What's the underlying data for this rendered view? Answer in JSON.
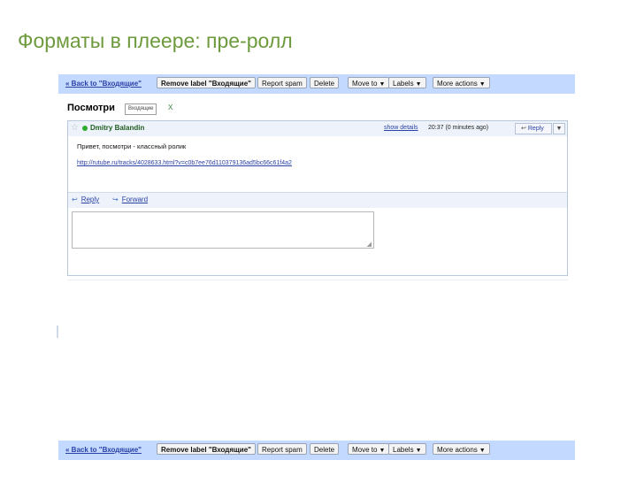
{
  "slide": {
    "title": "Форматы в плеере: пре-ролл"
  },
  "toolbar": {
    "back_label": "« Back to \"Входящие\"",
    "remove_label": "Remove label \"Входящие\"",
    "report_spam": "Report spam",
    "delete": "Delete",
    "move_to": "Move to",
    "labels": "Labels",
    "more_actions": "More actions"
  },
  "conversation": {
    "subject": "Посмотри",
    "label_chip": "Входящие",
    "label_remove": "X"
  },
  "message": {
    "sender": "Dmitry Balandin",
    "show_details": "show details",
    "time": "20:37 (0 minutes ago)",
    "reply_button": "Reply",
    "more_caret": "▼",
    "body": "Привет, посмотри - классный ролик",
    "link": "http://rutube.ru/tracks/4028633.html?v=c0b7ee76d110379136ad5bc66c61f4a2"
  },
  "actions": {
    "reply": "Reply",
    "forward": "Forward"
  },
  "colors": {
    "title_green": "#6d9a3c",
    "toolbar_blue": "#c3d9ff",
    "link_blue": "#2a41a6"
  }
}
